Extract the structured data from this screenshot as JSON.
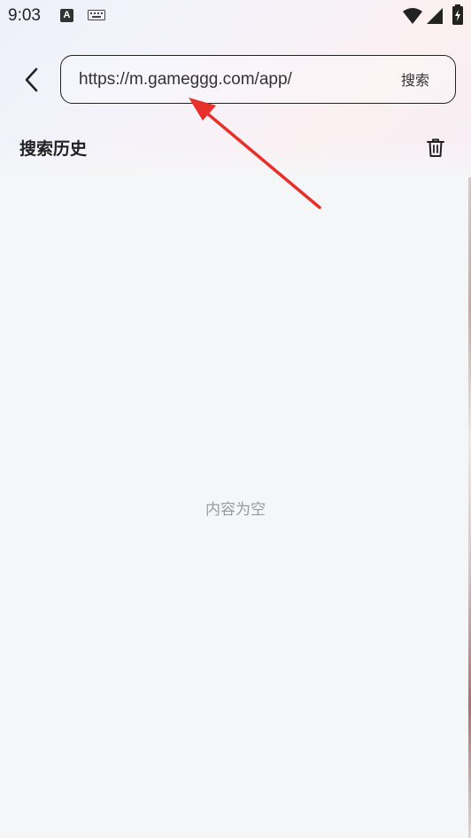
{
  "status_bar": {
    "time": "9:03",
    "notification_a": "A",
    "icons": [
      "notification-a-icon",
      "keyboard-icon",
      "wifi-icon",
      "signal-icon",
      "battery-charging-icon"
    ]
  },
  "header": {
    "back_icon": "chevron-left-icon",
    "search": {
      "value": "https://m.gameggg.com/app/",
      "button_label": "搜索"
    }
  },
  "history": {
    "title": "搜索历史",
    "clear_icon": "trash-icon"
  },
  "content": {
    "empty_text": "内容为空"
  },
  "annotation": {
    "arrow_icon": "red-arrow-annotation",
    "color": "#e8302a"
  }
}
